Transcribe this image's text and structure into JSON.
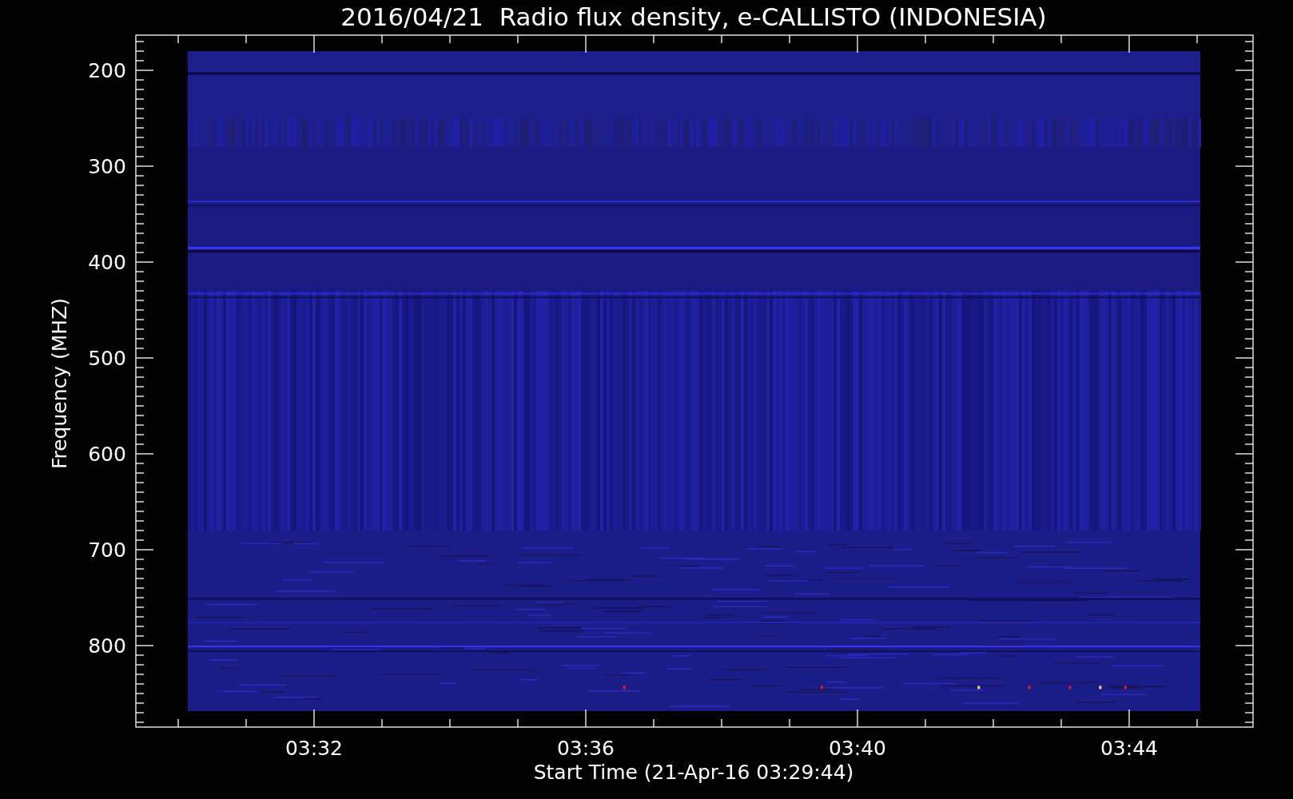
{
  "chart": {
    "title": "2016/04/21  Radio flux density, e-CALLISTO (INDONESIA)",
    "ylabel": "Frequency (MHZ)",
    "xlabel": "Start Time (21-Apr-16 03:29:44)",
    "yticks": [
      "200",
      "300",
      "400",
      "500",
      "600",
      "700",
      "800"
    ],
    "xticks": [
      "03:32",
      "03:36",
      "03:40",
      "03:44"
    ]
  }
}
